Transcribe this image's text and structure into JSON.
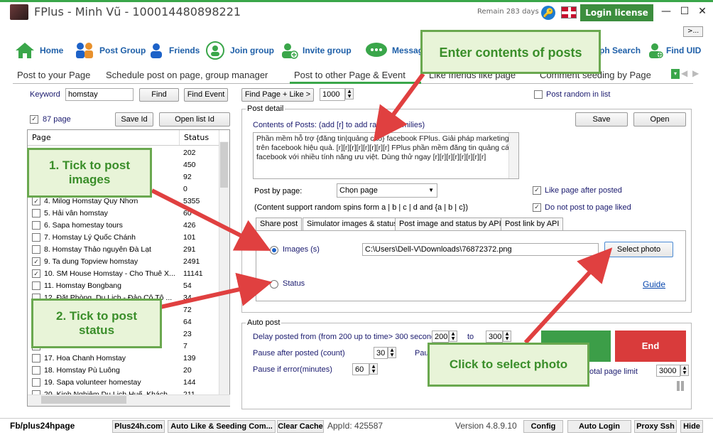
{
  "window": {
    "title": "FPlus - Minh Vũ - 100014480898221",
    "remain": "Remain 283 days",
    "login_license": "Login license",
    "collapse": ">..."
  },
  "toolbar": {
    "items": [
      {
        "label": "Home",
        "icon": "home-icon"
      },
      {
        "label": "Post Group",
        "icon": "post-group-icon"
      },
      {
        "label": "Friends",
        "icon": "friends-icon"
      },
      {
        "label": "Join group",
        "icon": "join-group-icon"
      },
      {
        "label": "Invite group",
        "icon": "invite-group-icon"
      },
      {
        "label": "Messag",
        "icon": "message-icon"
      },
      {
        "label": "ph Search",
        "icon": "graph-search-icon"
      },
      {
        "label": "Find UID",
        "icon": "find-uid-icon"
      }
    ]
  },
  "tabs": [
    {
      "label": "Post to your Page"
    },
    {
      "label": "Schedule post on page, group manager"
    },
    {
      "label": "Post to other Page & Event"
    },
    {
      "label": "Like friends like page"
    },
    {
      "label": "Comment seeding by Page"
    }
  ],
  "left": {
    "keyword_label": "Keyword",
    "keyword_value": "homstay",
    "find_btn": "Find",
    "find_event_btn": "Find Event",
    "find_page_like_btn": "Find Page + Like >",
    "count_value": "1000",
    "page_count_label": "87 page",
    "save_id_btn": "Save Id",
    "open_list_btn": "Open list Id",
    "col_page": "Page",
    "col_status": "Status",
    "rows": [
      {
        "name": "",
        "status": "202",
        "checked": false
      },
      {
        "name": "",
        "status": "450",
        "checked": false
      },
      {
        "name": "",
        "status": "92",
        "checked": false
      },
      {
        "name": "",
        "status": "0",
        "checked": false
      },
      {
        "name": "4. Milog Homstay Quy Nhơn",
        "status": "5355",
        "checked": true
      },
      {
        "name": "5. Hải vân homstay",
        "status": "60",
        "checked": false
      },
      {
        "name": "6. Sapa homestay tours",
        "status": "426",
        "checked": false
      },
      {
        "name": "7. Homstay Lý Quốc Chánh",
        "status": "101",
        "checked": false
      },
      {
        "name": "8. Homstay Thảo nguyên Đà Lạt",
        "status": "291",
        "checked": false
      },
      {
        "name": "9. Ta dung Topview homstay",
        "status": "2491",
        "checked": true
      },
      {
        "name": "10. SM House Homstay - Cho Thuê X...",
        "status": "11141",
        "checked": true
      },
      {
        "name": "11. Homstay Bongbang",
        "status": "54",
        "checked": false
      },
      {
        "name": "12. Đặt Phòng, Du Lịch - Đảo Cô Tô ...",
        "status": "34",
        "checked": false
      },
      {
        "name": "",
        "status": "72",
        "checked": false
      },
      {
        "name": "",
        "status": "64",
        "checked": false
      },
      {
        "name": "t",
        "status": "23",
        "checked": false
      },
      {
        "name": "",
        "status": "7",
        "checked": false
      },
      {
        "name": "17. Hoa Chanh Homstay",
        "status": "139",
        "checked": false
      },
      {
        "name": "18. Homstay Pù Luông",
        "status": "20",
        "checked": false
      },
      {
        "name": "19. Sapa volunteer homestay",
        "status": "144",
        "checked": false
      },
      {
        "name": "20. Kinh Nghiệm Du Lịch Huế, Khách...",
        "status": "211",
        "checked": false
      }
    ]
  },
  "post_detail": {
    "post_random_label": "Post random in list",
    "legend": "Post detail",
    "contents_label": "Contents of Posts: (add [r] to add random smilies)",
    "save_btn": "Save",
    "open_btn": "Open",
    "content_text": "Phần mềm hỗ trợ {đăng tin|quảng cáo} facebook FPlus. Giải pháp marketing trên facebook hiệu quả. [r][r][r][r][r][r][r][r] FPlus phần mềm đăng tin quảng cáo facebook với nhiều tính năng ưu việt. Dùng thử ngay [r][r][r][r][r][r][r][r]",
    "post_by_page_label": "Post by page:",
    "post_by_page_value": "Chọn page",
    "like_after_label": "Like page after posted",
    "spins_note": "(Content support random spins form a | b | c | d and {a | b | c})",
    "not_liked_label": "Do not post to page liked",
    "subtabs": [
      {
        "label": "Share post"
      },
      {
        "label": "Simulator images & status"
      },
      {
        "label": "Post image and status by API"
      },
      {
        "label": "Post link by API"
      }
    ],
    "images_label": "Images (s)",
    "image_path": "C:\\Users\\Dell-V\\Downloads\\76872372.png",
    "select_photo_btn": "Select photo",
    "status_label": "Status",
    "guide_link": "Guide"
  },
  "auto_post": {
    "legend": "Auto post",
    "delay_label": "Delay posted from (from 200 up to time> 300 seconds)",
    "delay_from": "200",
    "to_label": "to",
    "delay_to": "300",
    "pause_after_label": "Pause after posted (count)",
    "pause_after_value": "30",
    "pause_trunc": "Paus",
    "pause_error_label": "Pause if error(minutes)",
    "pause_error_value": "60",
    "total_limit_label": "otal page limit",
    "total_limit_value": "3000",
    "end_btn": "End"
  },
  "statusbar": {
    "fb": "Fb/plus24hpage",
    "plus24h": "Plus24h.com",
    "auto_like": "Auto Like & Seeding Com...",
    "clear_cache": "Clear Cache",
    "appid": "AppId: 425587",
    "version": "Version 4.8.9.10",
    "config": "Config",
    "auto_login": "Auto Login",
    "proxy_ssh": "Proxy Ssh",
    "hide": "Hide"
  },
  "callouts": {
    "enter_contents": "Enter contents of posts",
    "tick_images": "1. Tick to post images",
    "tick_status": "2. Tick to post status",
    "click_select": "Click to select photo"
  },
  "colors": {
    "accent_green": "#3aa64a",
    "callout_bg": "#e8f4d8",
    "arrow_red": "#e04040",
    "end_red": "#d93b3b"
  }
}
